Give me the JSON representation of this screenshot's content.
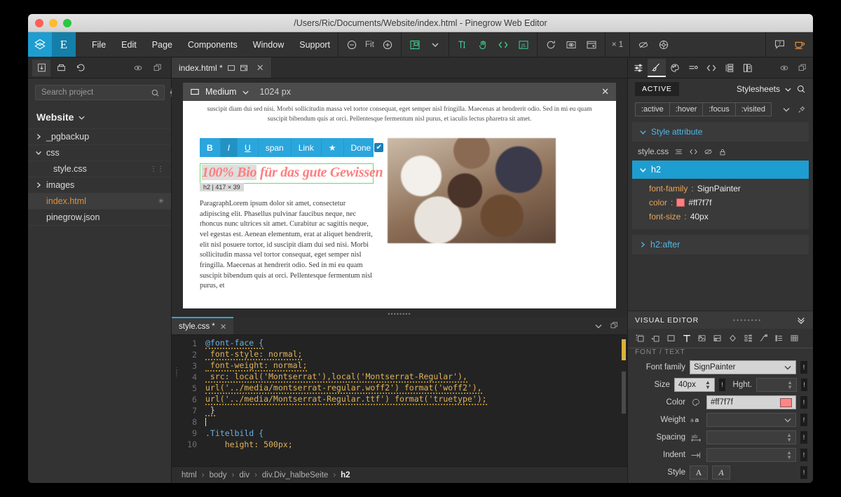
{
  "window": {
    "title": "/Users/Ric/Documents/Website/index.html - Pinegrow Web Editor"
  },
  "menubar": {
    "items": [
      "File",
      "Edit",
      "Page",
      "Components",
      "Window",
      "Support"
    ],
    "zoom_fit_label": "Fit",
    "multiplier_label": "× 1"
  },
  "sidebar": {
    "search_placeholder": "Search project",
    "search_value": "",
    "project_title": "Website",
    "tree": [
      {
        "label": "_pgbackup",
        "twisty": "collapsed",
        "indent": 0,
        "selected": false,
        "modified": false
      },
      {
        "label": "css",
        "twisty": "expanded",
        "indent": 0,
        "selected": false,
        "modified": false
      },
      {
        "label": "style.css",
        "twisty": "none",
        "indent": 1,
        "selected": false,
        "modified": false,
        "trail": "⋮⋮"
      },
      {
        "label": "images",
        "twisty": "collapsed",
        "indent": 0,
        "selected": false,
        "modified": false
      },
      {
        "label": "index.html",
        "twisty": "none",
        "indent": 0,
        "selected": true,
        "modified": true
      },
      {
        "label": "pinegrow.json",
        "twisty": "none",
        "indent": 0,
        "selected": false,
        "modified": false
      }
    ]
  },
  "center": {
    "tab_label": "index.html *",
    "device": {
      "name": "Medium",
      "width_label": "1024 px"
    },
    "preview": {
      "top_paragraph": "suscipit diam dui sed nisi. Morbi sollicitudin massa vel tortor consequat, eget semper nisl fringilla. Maecenas at hendrerit odio. Sed in mi eu quam suscipit bibendum quis at orci. Pellentesque fermentum nisl purus, et iaculis lectus pharetra sit amet.",
      "format_toolbar": [
        "B",
        "I",
        "U",
        "span",
        "Link",
        "★",
        "Done"
      ],
      "heading_text_selected": "100% ",
      "heading_text_highlight": "Bio",
      "heading_text_rest": " für das gute Gewissen",
      "element_badge": "h2 | 417 × 39",
      "body_paragraph": "ParagraphLorem ipsum dolor sit amet, consectetur adipiscing elit. Phasellus pulvinar faucibus neque, nec rhoncus nunc ultrices sit amet. Curabitur ac sagittis neque, vel egestas est. Aenean elementum, erat at aliquet hendrerit, elit nisl posuere tortor, id suscipit diam dui sed nisi. Morbi sollicitudin massa vel tortor consequat, eget semper nisl fringilla. Maecenas at hendrerit odio. Sed in mi eu quam suscipit bibendum quis at orci. Pellentesque fermentum nisl purus, et",
      "image_alt": "muffins-photo"
    },
    "code": {
      "tab_label": "style.css *",
      "lines": [
        {
          "n": "1",
          "text": "@font-face {"
        },
        {
          "n": "2",
          "text": " font-style: normal;"
        },
        {
          "n": "3",
          "text": " font-weight: normal;"
        },
        {
          "n": "4",
          "text": " src: local('Montserrat'),local('Montserrat-Regular'),"
        },
        {
          "n": "5",
          "text": "url('../media/montserrat-regular.woff2') format('woff2'),"
        },
        {
          "n": "6",
          "text": "url('../media/Montserrat-Regular.ttf') format('truetype');"
        },
        {
          "n": "7",
          "text": " }"
        },
        {
          "n": "8",
          "text": ""
        },
        {
          "n": "9",
          "text": ".Titelbild {"
        },
        {
          "n": "10",
          "text": "    height: 500px;"
        }
      ]
    },
    "breadcrumb": [
      "html",
      "body",
      "div",
      "div.Div_halbeSeite",
      "h2"
    ]
  },
  "rightpanel": {
    "active_chip": "ACTIVE",
    "stylesheets_label": "Stylesheets",
    "states": [
      ":active",
      ":hover",
      ":focus",
      ":visited"
    ],
    "style_attribute_label": "Style attribute",
    "sheet_name": "style.css",
    "rule_selector": "h2",
    "declarations": [
      {
        "property": "font-family",
        "value": "SignPainter",
        "swatch": null
      },
      {
        "property": "color",
        "value": "#ff7f7f",
        "swatch": "#ff7f7f"
      },
      {
        "property": "font-size",
        "value": "40px",
        "swatch": null
      }
    ],
    "collapsed_rule": "h2:after",
    "visual_editor": {
      "title": "VISUAL EDITOR",
      "section_label": "FONT / TEXT",
      "fields": [
        {
          "label": "Font family",
          "value": "SignPainter",
          "kind": "select-light"
        },
        {
          "label": "Size",
          "value": "40px",
          "kind": "stepper-light"
        },
        {
          "label": "Hght.",
          "value": "",
          "kind": "stepper"
        },
        {
          "label": "Color",
          "value": "#ff7f7f",
          "kind": "color",
          "swatch": "#ff7f7f"
        },
        {
          "label": "Weight",
          "value": "",
          "kind": "select"
        },
        {
          "label": "Spacing",
          "value": "",
          "kind": "stepper"
        },
        {
          "label": "Indent",
          "value": "",
          "kind": "stepper"
        },
        {
          "label": "Style",
          "value": "",
          "kind": "buttons",
          "buttons": [
            "A",
            "A"
          ]
        }
      ]
    }
  },
  "colors": {
    "accent_blue": "#1e9dd0",
    "accent_green": "#3ddc97",
    "accent_orange": "#e0903f",
    "h2_color": "#ff7f7f",
    "selection_outline": "#62e062"
  }
}
